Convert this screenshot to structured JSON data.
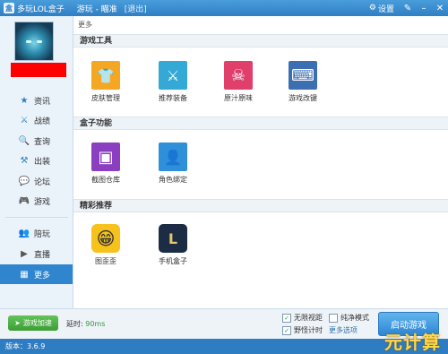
{
  "titlebar": {
    "title": "多玩LOL盒子",
    "user": "游玩 - 瞄准",
    "logout": "[退出]",
    "settings": "设置"
  },
  "sidebar": {
    "items": [
      {
        "label": "资讯",
        "icon": "star-icon",
        "glyph": "★"
      },
      {
        "label": "战绩",
        "icon": "scoreboard-icon",
        "glyph": "⚔"
      },
      {
        "label": "查询",
        "icon": "search-icon",
        "glyph": "🔍"
      },
      {
        "label": "出装",
        "icon": "equipment-icon",
        "glyph": "⚒"
      },
      {
        "label": "论坛",
        "icon": "forum-icon",
        "glyph": "💬"
      },
      {
        "label": "游戏",
        "icon": "gamepad-icon",
        "glyph": "🎮"
      },
      {
        "label": "陪玩",
        "icon": "companion-icon",
        "glyph": "👥"
      },
      {
        "label": "直播",
        "icon": "live-icon",
        "glyph": "▶"
      },
      {
        "label": "更多",
        "icon": "more-icon",
        "glyph": "▦"
      }
    ]
  },
  "main": {
    "breadcrumb": "更多",
    "sections": [
      {
        "title": "游戏工具",
        "tiles": [
          {
            "label": "皮肤管理",
            "icon": "shirt-icon",
            "color": "#f5a623",
            "glyph": "👕"
          },
          {
            "label": "推荐装备",
            "icon": "gear-recommend-icon",
            "color": "#35a9d6",
            "glyph": "⚔"
          },
          {
            "label": "原汁原味",
            "icon": "skull-icon",
            "color": "#e03e6b",
            "glyph": "☠"
          },
          {
            "label": "游戏改键",
            "icon": "keyboard-icon",
            "color": "#3c6fb2",
            "glyph": "⌨"
          }
        ]
      },
      {
        "title": "盒子功能",
        "tiles": [
          {
            "label": "截图仓库",
            "icon": "screenshot-icon",
            "color": "#8a3fc0",
            "glyph": "▣"
          },
          {
            "label": "角色绑定",
            "icon": "user-bind-icon",
            "color": "#2f8fd8",
            "glyph": "👤"
          }
        ]
      },
      {
        "title": "精彩推荐",
        "tiles": [
          {
            "label": "图歪歪",
            "icon": "smiley-icon",
            "color": "#f6c21b",
            "glyph": "😁"
          },
          {
            "label": "手机盒子",
            "icon": "mobile-box-icon",
            "color": "#1d2c45",
            "glyph": "L"
          }
        ]
      }
    ]
  },
  "bottom": {
    "accelerate_label": "游戏加速",
    "latency_label": "延时:",
    "latency_value": "90ms",
    "options": {
      "unlimited_view": {
        "label": "无限视距",
        "checked": true
      },
      "pure_mode": {
        "label": "纯净模式",
        "checked": false
      },
      "jungle_timer": {
        "label": "野怪计时",
        "checked": true
      }
    },
    "more_options": "更多选项",
    "launch_label": "启动游戏"
  },
  "status": {
    "version": "版本：3.6.9",
    "watermark": "元计算"
  },
  "colors": {
    "accent": "#2f86cf",
    "title_bar": "#3a8ad0",
    "launch": "#3a90d9",
    "accelerate": "#4cae43"
  }
}
